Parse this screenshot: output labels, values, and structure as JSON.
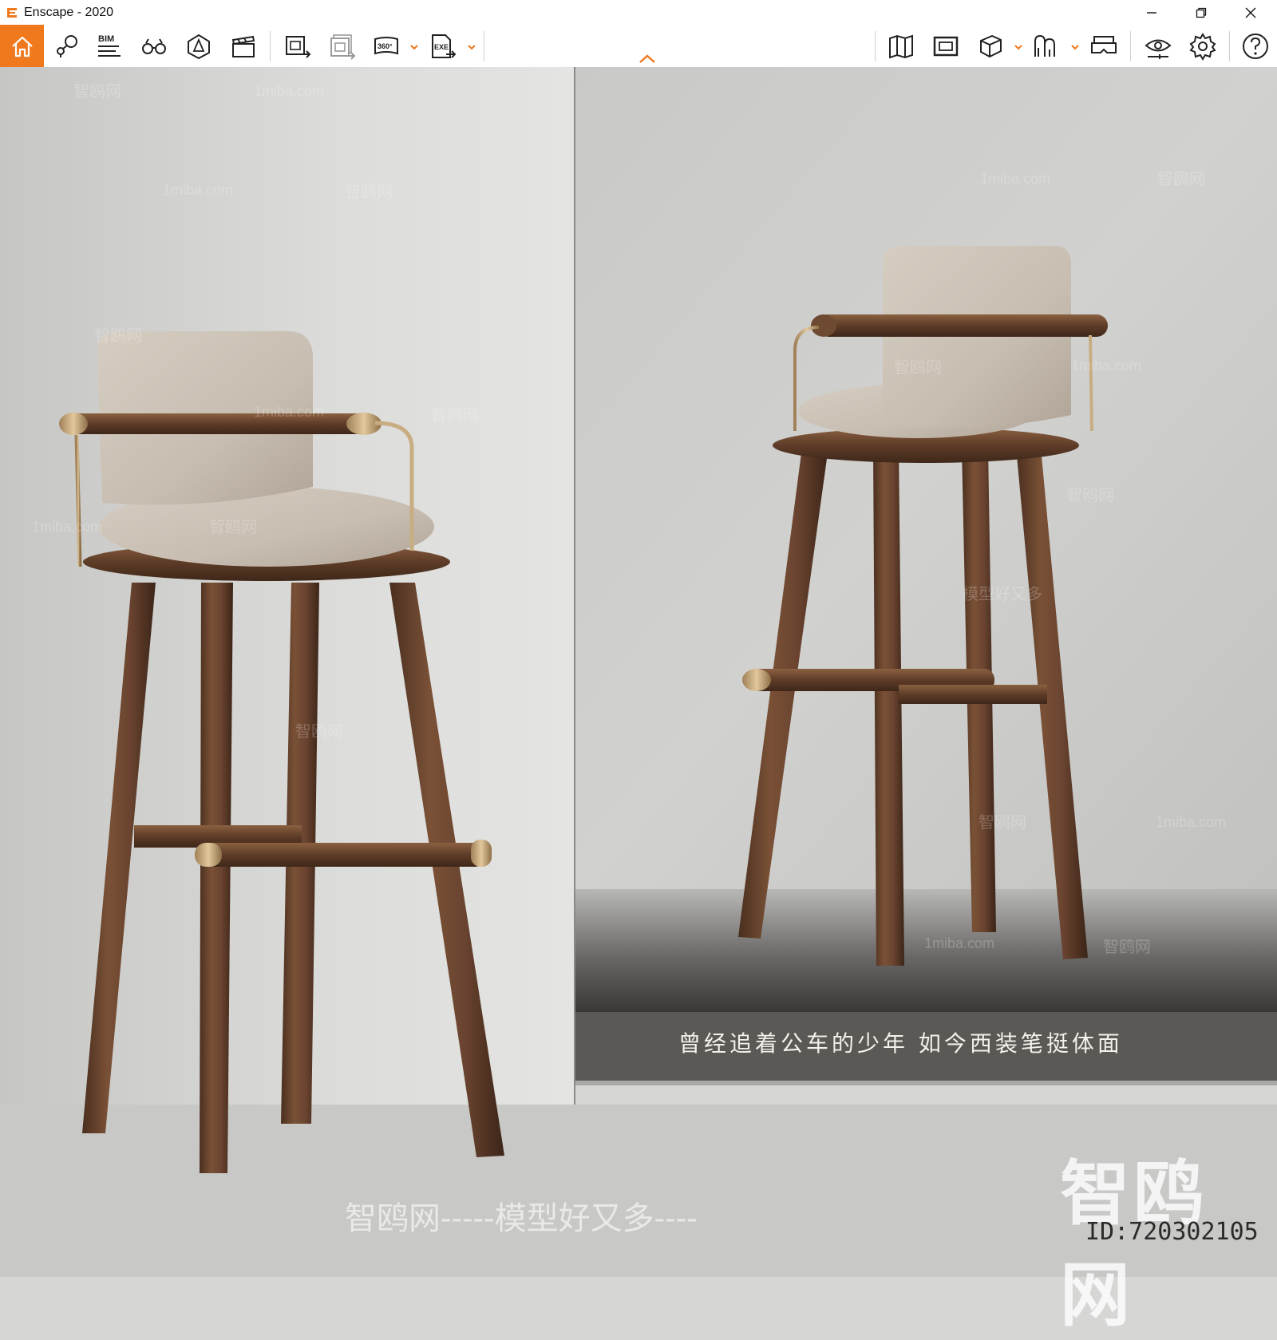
{
  "window": {
    "title": "Enscape - 2020",
    "controls": [
      "minimize-icon",
      "restore-icon",
      "close-icon"
    ]
  },
  "toolbar": {
    "left_tools": [
      {
        "name": "home-icon",
        "active": true
      },
      {
        "name": "views-pin-icon"
      },
      {
        "name": "bim-info-icon",
        "label": "BIM"
      },
      {
        "name": "binoculars-icon"
      },
      {
        "name": "asset-library-icon"
      },
      {
        "name": "video-editor-icon"
      },
      {
        "name": "screenshot-export-icon"
      },
      {
        "name": "batch-export-icon"
      },
      {
        "name": "panorama-export-icon",
        "label": "360°"
      },
      {
        "name": "exe-export-icon",
        "label": "EXE"
      }
    ],
    "right_tools": [
      {
        "name": "map-icon"
      },
      {
        "name": "minimap-icon"
      },
      {
        "name": "cube-icon"
      },
      {
        "name": "atmosphere-icon"
      },
      {
        "name": "vr-headset-icon"
      },
      {
        "name": "visual-settings-eye-icon"
      },
      {
        "name": "settings-gear-icon"
      },
      {
        "name": "help-icon"
      }
    ],
    "accent_color": "#f0791e"
  },
  "render": {
    "caption": "曾经追着公车的少年 如今西装笔挺体面",
    "bottom_watermark": "智鸥网-----模型好又多----",
    "corner_watermark": "智鸥网",
    "image_id": "ID:720302105",
    "watermarks": [
      "智鸥网",
      "1miba.com",
      "1miba.com",
      "智鸥网",
      "1miba.com",
      "智鸥网",
      "智鸥网",
      "1miba.com",
      "智鸥网",
      "1miba.com",
      "智鸥网",
      "智鸥网",
      "1miba.com",
      "智鸥网",
      "模型好又多",
      "智鸥网",
      "1miba.com",
      "智鸥网",
      "1miba.com",
      "智鸥网"
    ]
  }
}
